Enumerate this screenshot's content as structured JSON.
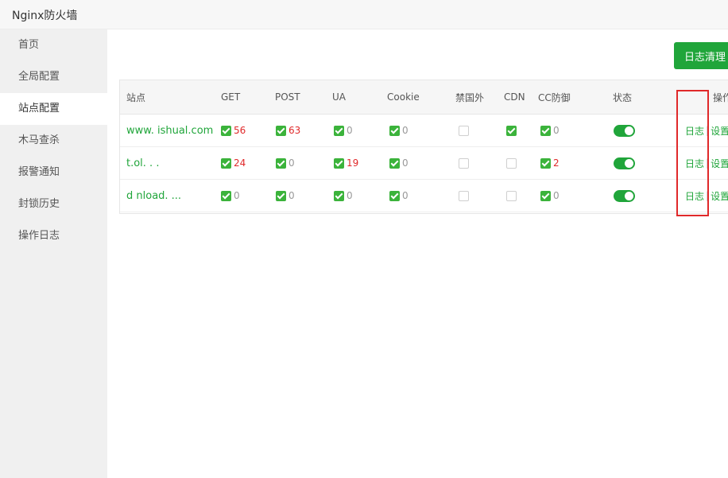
{
  "app": {
    "title": "Nginx防火墙"
  },
  "sidebar": {
    "items": [
      {
        "label": "首页"
      },
      {
        "label": "全局配置"
      },
      {
        "label": "站点配置"
      },
      {
        "label": "木马查杀"
      },
      {
        "label": "报警通知"
      },
      {
        "label": "封锁历史"
      },
      {
        "label": "操作日志"
      }
    ],
    "active_index": 2
  },
  "toolbar": {
    "clean_log_label": "日志清理"
  },
  "table": {
    "headers": {
      "site": "站点",
      "get": "GET",
      "post": "POST",
      "ua": "UA",
      "cookie": "Cookie",
      "foreign": "禁国外",
      "cdn": "CDN",
      "cc": "CC防御",
      "status": "状态",
      "actions": "操作"
    },
    "rows": [
      {
        "site": "www.  ishual.com",
        "get": {
          "checked": true,
          "count": "56"
        },
        "post": {
          "checked": true,
          "count": "63"
        },
        "ua": {
          "checked": true,
          "count": "0"
        },
        "cookie": {
          "checked": true,
          "count": "0"
        },
        "foreign": false,
        "cdn": true,
        "cc": {
          "checked": true,
          "count": "0"
        },
        "status": true,
        "log_label": "日志",
        "settings_label": "设置"
      },
      {
        "site": "t.ol.  .  .",
        "get": {
          "checked": true,
          "count": "24"
        },
        "post": {
          "checked": true,
          "count": "0"
        },
        "ua": {
          "checked": true,
          "count": "19"
        },
        "cookie": {
          "checked": true,
          "count": "0"
        },
        "foreign": false,
        "cdn": false,
        "cc": {
          "checked": true,
          "count": "2"
        },
        "status": true,
        "log_label": "日志",
        "settings_label": "设置"
      },
      {
        "site": "d nload. ...",
        "get": {
          "checked": true,
          "count": "0"
        },
        "post": {
          "checked": true,
          "count": "0"
        },
        "ua": {
          "checked": true,
          "count": "0"
        },
        "cookie": {
          "checked": true,
          "count": "0"
        },
        "foreign": false,
        "cdn": false,
        "cc": {
          "checked": true,
          "count": "0"
        },
        "status": true,
        "log_label": "日志",
        "settings_label": "设置"
      }
    ]
  },
  "colors": {
    "accent": "#20a53a",
    "alert": "#e0292a",
    "highlight_box": "#e0292a"
  }
}
